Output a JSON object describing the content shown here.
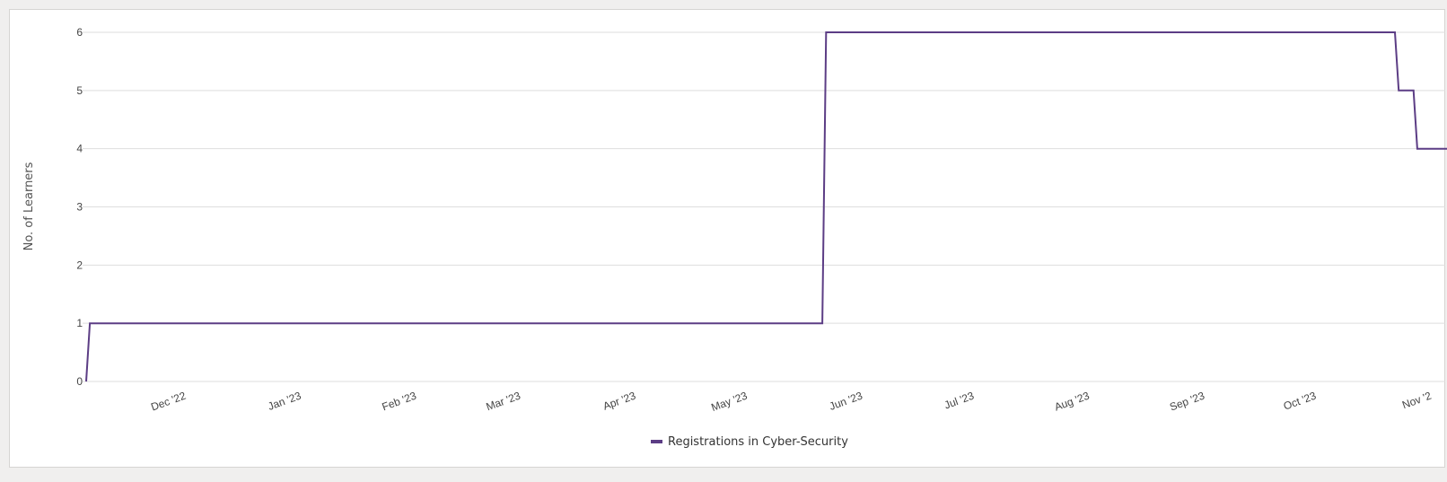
{
  "chart_data": {
    "type": "line",
    "step": true,
    "title": "",
    "xlabel": "",
    "ylabel": "No. of Learners",
    "ylim": [
      0,
      6
    ],
    "yticks": [
      0,
      1,
      2,
      3,
      4,
      5,
      6
    ],
    "xlim": [
      "2022-11-04",
      "2023-11-05"
    ],
    "xticks": [
      {
        "date": "2022-12-01",
        "label": "Dec '22"
      },
      {
        "date": "2023-01-01",
        "label": "Jan '23"
      },
      {
        "date": "2023-02-01",
        "label": "Feb '23"
      },
      {
        "date": "2023-03-01",
        "label": "Mar '23"
      },
      {
        "date": "2023-04-01",
        "label": "Apr '23"
      },
      {
        "date": "2023-05-01",
        "label": "May '23"
      },
      {
        "date": "2023-06-01",
        "label": "Jun '23"
      },
      {
        "date": "2023-07-01",
        "label": "Jul '23"
      },
      {
        "date": "2023-08-01",
        "label": "Aug '23"
      },
      {
        "date": "2023-09-01",
        "label": "Sep '23"
      },
      {
        "date": "2023-10-01",
        "label": "Oct '23"
      },
      {
        "date": "2023-11-01",
        "label": "Nov '2"
      }
    ],
    "grid": true,
    "legend": "bottom-center",
    "series": [
      {
        "name": "Registrations in Cyber-Security",
        "color": "#5c3d85",
        "points": [
          {
            "x": "2022-11-04",
            "y": 0
          },
          {
            "x": "2022-11-05",
            "y": 1
          },
          {
            "x": "2023-05-21",
            "y": 1
          },
          {
            "x": "2023-05-22",
            "y": 6
          },
          {
            "x": "2023-10-22",
            "y": 6
          },
          {
            "x": "2023-10-23",
            "y": 5
          },
          {
            "x": "2023-10-27",
            "y": 5
          },
          {
            "x": "2023-10-28",
            "y": 4
          },
          {
            "x": "2023-11-05",
            "y": 4
          }
        ]
      }
    ]
  }
}
